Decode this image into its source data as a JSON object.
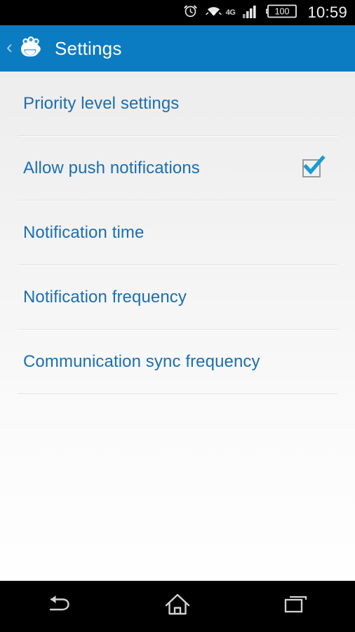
{
  "status_bar": {
    "time": "10:59",
    "battery_level": "100",
    "network_type": "4G",
    "icons": [
      "alarm-clock-icon",
      "wifi-icon",
      "network-4g-icon",
      "signal-bars-icon",
      "battery-icon"
    ]
  },
  "action_bar": {
    "back_label": "‹",
    "title": "Settings",
    "app_icon": "app-mascot-icon"
  },
  "settings_list": {
    "rows": [
      {
        "label": "Priority level settings",
        "type": "link",
        "name": "priority-level-settings"
      },
      {
        "label": "Allow push notifications",
        "type": "checkbox",
        "checked": true,
        "name": "allow-push-notifications"
      },
      {
        "label": "Notification time",
        "type": "link",
        "name": "notification-time"
      },
      {
        "label": "Notification frequency",
        "type": "link",
        "name": "notification-frequency"
      },
      {
        "label": "Communication sync frequency",
        "type": "link",
        "name": "communication-sync-frequency"
      }
    ]
  },
  "nav_bar": {
    "buttons": [
      {
        "name": "back-button",
        "icon": "back-arrow-icon"
      },
      {
        "name": "home-button",
        "icon": "home-icon"
      },
      {
        "name": "recents-button",
        "icon": "recent-apps-icon"
      }
    ]
  },
  "colors": {
    "action_bar": "#0b7cc2",
    "link_text": "#1c6fb0",
    "checkbox_check": "#1a9ad4",
    "status_bar": "#000000",
    "nav_bar": "#000000"
  }
}
